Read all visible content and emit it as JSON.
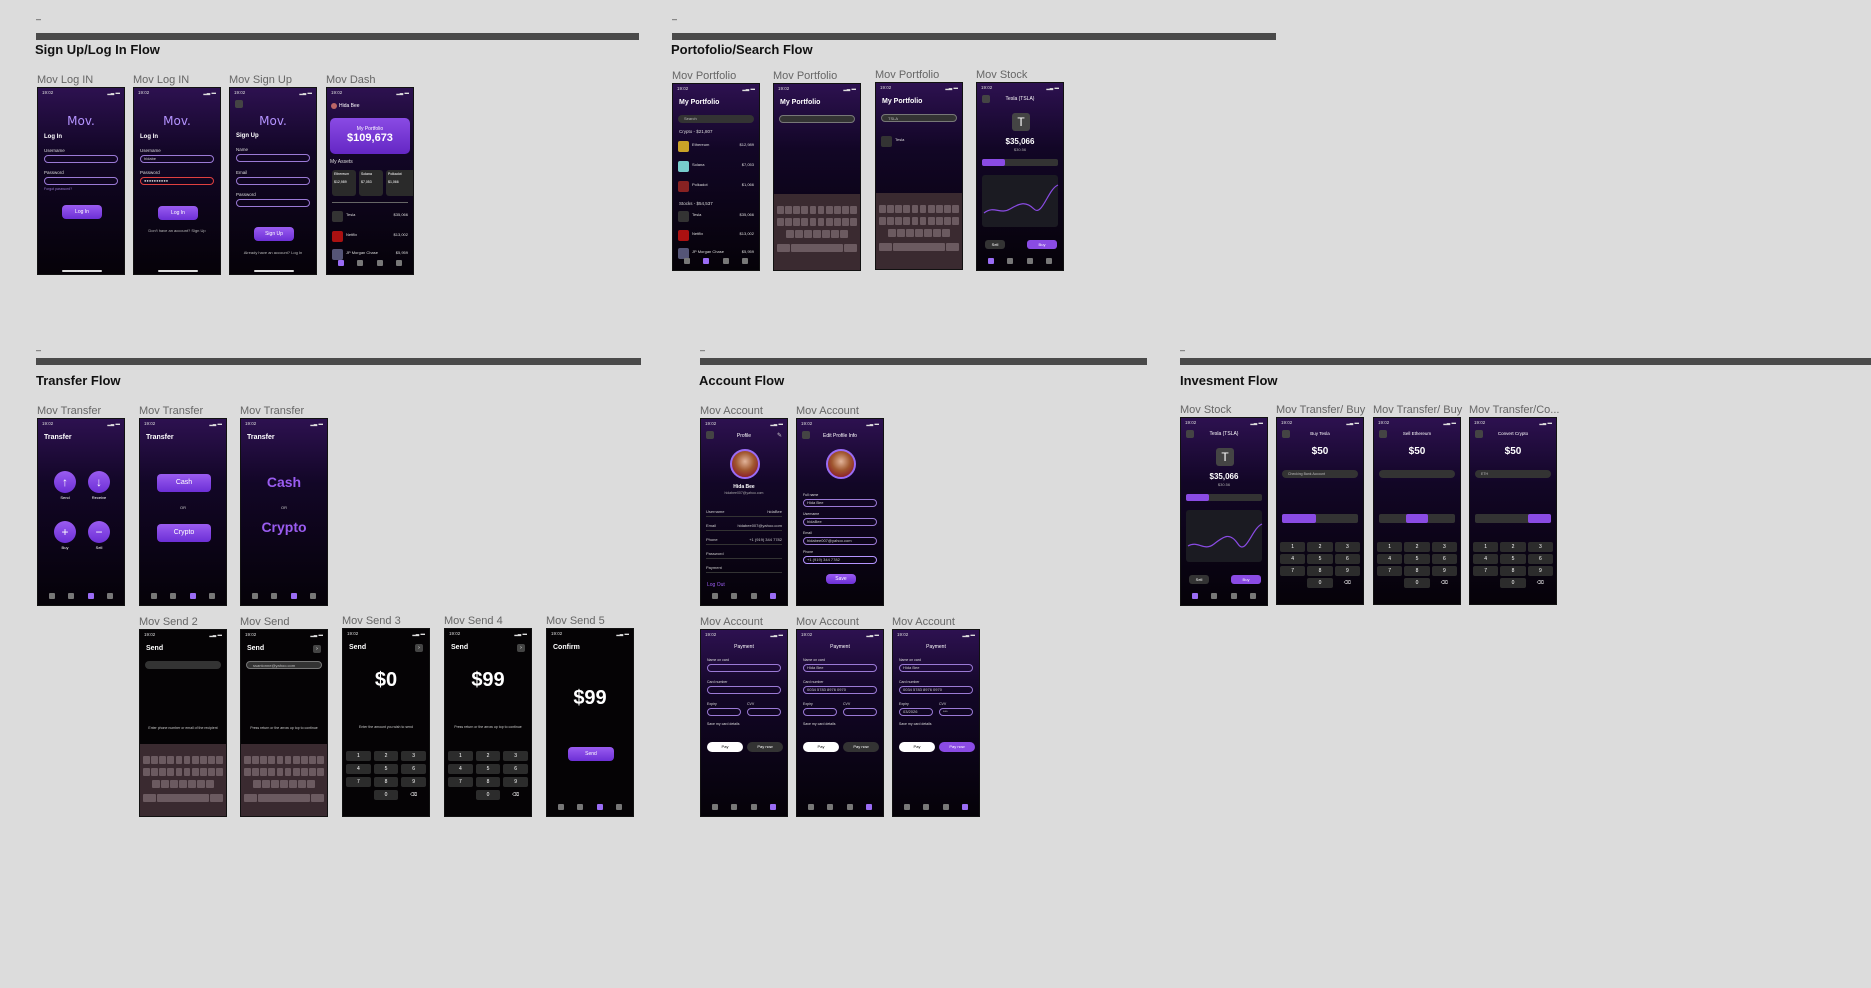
{
  "sections": {
    "signup": {
      "dash": "–",
      "title": "Sign Up/Log In  Flow"
    },
    "portfolio": {
      "dash": "–",
      "title": "Portofolio/Search Flow"
    },
    "transfer": {
      "dash": "–",
      "title": "Transfer Flow"
    },
    "account": {
      "dash": "–",
      "title": "Account Flow"
    },
    "investment": {
      "dash": "–",
      "title": "Invesment Flow"
    }
  },
  "labels": {
    "login1": "Mov Log IN",
    "login2": "Mov Log IN",
    "signup": "Mov Sign Up",
    "dash": "Mov Dash",
    "port1": "Mov Portfolio",
    "port2": "Mov Portfolio",
    "port3": "Mov Portfolio",
    "stock": "Mov Stock",
    "tr1": "Mov Transfer",
    "tr2": "Mov Transfer",
    "tr3": "Mov Transfer",
    "send2": "Mov Send 2",
    "send": "Mov Send",
    "send3": "Mov Send 3",
    "send4": "Mov Send 4",
    "send5": "Mov Send 5",
    "acc1": "Mov Account",
    "acc2": "Mov Account",
    "acc3": "Mov Account",
    "acc4": "Mov Account",
    "acc5": "Mov Account",
    "inv1": "Mov Stock",
    "inv2": "Mov Transfer/ Buy",
    "inv3": "Mov Transfer/ Buy",
    "inv4": "Mov Transfer/Co..."
  },
  "phone": {
    "time": "19:02",
    "logo": "Mov.",
    "login_title": "Log In",
    "signup_title": "Sign Up",
    "username": "Username",
    "username_value": "hidabe",
    "password": "Password",
    "name": "Name",
    "email": "Email",
    "forgot": "Forgot password?",
    "login_btn": "Log In",
    "signup_btn": "Sign Up",
    "no_account": "Don't have an account? Sign Up",
    "have_account": "Already have an account? Log In",
    "user_name": "Hida Bee",
    "my_portfolio": "My Portfolio",
    "portfolio_value": "$109,673",
    "my_assets": "My Assets",
    "search": "Search",
    "search_value": "TSLA",
    "crypto_header": "Crypto - $21,807",
    "stocks_header": "Stocks - $54,537",
    "assets": [
      {
        "name": "Ethereum",
        "value": "$12,989"
      },
      {
        "name": "Solana",
        "value": "$7,053"
      },
      {
        "name": "Polkadot",
        "value": "$1,066"
      },
      {
        "name": "Tesla",
        "value": "$35,066"
      },
      {
        "name": "Netflix",
        "value": "$13,002"
      },
      {
        "name": "JP Morgan Chase",
        "value": "$5,959"
      }
    ],
    "tesla_title": "Tesla (TSLA)",
    "tesla_price": "$35,066",
    "tesla_sub": "$30.56",
    "ranges": [
      "1 week",
      "1 month",
      "1 year"
    ],
    "sell": "Sell",
    "buy": "Buy",
    "transfer_title": "Transfer",
    "send_lbl": "Send",
    "receive_lbl": "Receive",
    "buy_lbl": "Buy",
    "sell_lbl": "Sell",
    "cash": "Cash",
    "or": "OR",
    "crypto": "Crypto",
    "send_title": "Send",
    "send_hint": "Enter phone number or email of the recipient",
    "send_email": "ssantonne@yahoo.com",
    "send_hint2": "Press return or the arrow up top to continue",
    "amount0": "$0",
    "amount99": "$99",
    "enter_amount": "Enter the amount you wish to send",
    "confirm": "Confirm",
    "send_btn": "Send",
    "profile": "Profile",
    "edit_profile": "Edit Profile Info",
    "profile_email": "hidabee007@yahoo.com",
    "rows": [
      "Username",
      "Email",
      "Phone",
      "Password",
      "Payment"
    ],
    "row_values": [
      "hidaBee",
      "hidabee007@yahoo.com",
      "+1 (919) 344 7782",
      "",
      ""
    ],
    "logout": "Log Out",
    "full_name": "Full name",
    "full_name_v": "Hida Bee",
    "phone_label": "Phone",
    "phone_v": "+1 (919) 344 7782",
    "save": "Save",
    "payment": "Payment",
    "name_on_card": "Name on card",
    "card_number": "Card number",
    "card_number_v": "0034 5783 8976 0970",
    "expiry": "Expiry",
    "expiry_v": "03/2026",
    "cvv": "CVV",
    "cvv_v": "***",
    "save_details": "Save my card details",
    "apple_pay": "Pay",
    "pay_now": "Pay now",
    "buy_tesla": "Buy Tesla",
    "sell_ethereum": "Sell Ethereum",
    "convert_crypto": "Convert Crypto",
    "fifty": "$50",
    "account_choice": "Checking Bank Account",
    "convert": "Convert",
    "eth": "ETH",
    "numkeys": [
      "1",
      "2",
      "3",
      "4",
      "5",
      "6",
      "7",
      "8",
      "9",
      "",
      "0",
      "⌫"
    ]
  },
  "colors": {
    "accent": "#8a4be4",
    "bg": "#dcdcdc"
  }
}
